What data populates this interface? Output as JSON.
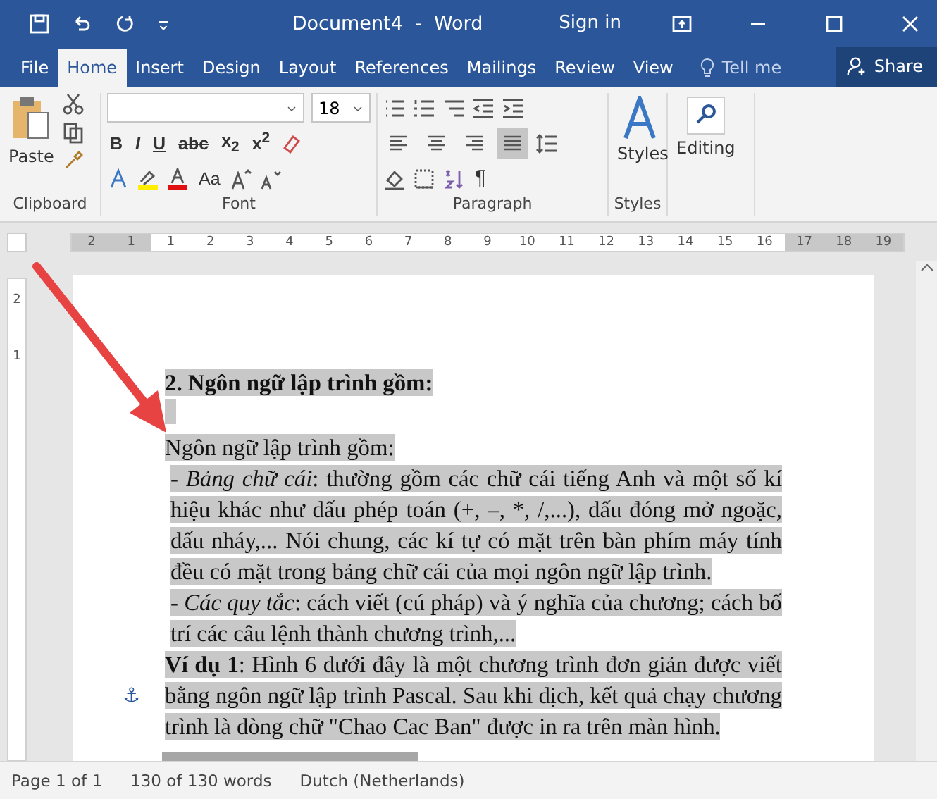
{
  "window": {
    "title": "Document4  -  Word",
    "sign_in": "Sign in"
  },
  "tabs": [
    {
      "label": "File",
      "selected": false
    },
    {
      "label": "Home",
      "selected": true
    },
    {
      "label": "Insert",
      "selected": false
    },
    {
      "label": "Design",
      "selected": false
    },
    {
      "label": "Layout",
      "selected": false
    },
    {
      "label": "References",
      "selected": false
    },
    {
      "label": "Mailings",
      "selected": false
    },
    {
      "label": "Review",
      "selected": false
    },
    {
      "label": "View",
      "selected": false
    }
  ],
  "tell_me": "Tell me",
  "share": "Share",
  "ribbon": {
    "clipboard": {
      "paste": "Paste",
      "label": "Clipboard"
    },
    "font": {
      "size": "18",
      "format_buttons": [
        "B",
        "I",
        "U",
        "abc",
        "x$_{2}$",
        "x$^{2}$"
      ],
      "case_button": "Aa",
      "label": "Font"
    },
    "paragraph": {
      "alignments": [
        {
          "kind": "left",
          "selected": false
        },
        {
          "kind": "center",
          "selected": false
        },
        {
          "kind": "right",
          "selected": false
        },
        {
          "kind": "justify",
          "selected": true
        }
      ],
      "pilcrow": "¶",
      "label": "Paragraph"
    },
    "styles": {
      "button": "Styles",
      "label": "Styles"
    },
    "editing": {
      "button": "Editing"
    }
  },
  "ruler": {
    "labels": [
      "2",
      "1",
      "1",
      "2",
      "3",
      "4",
      "5",
      "6",
      "7",
      "8",
      "9",
      "10",
      "11",
      "12",
      "13",
      "14",
      "15",
      "16",
      "17",
      "18",
      "19"
    ],
    "vertical_labels": [
      "2",
      "1"
    ]
  },
  "document": {
    "paragraphs": [
      {
        "kind": "heading",
        "text": "2. Ngôn ngữ lập trình gồm:"
      },
      {
        "kind": "blank"
      },
      {
        "kind": "body",
        "text": "Ngôn ngữ lập trình gồm:"
      },
      {
        "kind": "item",
        "text": "- *Bảng chữ cái*: thường gồm các chữ cái tiếng Anh và một số kí hiệu khác như dấu phép toán (+, –, *, /,...), dấu đóng mở ngoặc, dấu nháy,... Nói chung, các kí tự có mặt trên bàn phím máy tính đều có mặt trong bảng chữ cái của mọi ngôn ngữ lập trình."
      },
      {
        "kind": "item",
        "text": "- *Các quy tắc*: cách viết (cú pháp) và ý nghĩa của chương; cách bố trí các câu lệnh thành chương trình,..."
      },
      {
        "kind": "example",
        "text": "**Ví dụ 1**: Hình 6 dưới đây là một chương trình đơn giản được viết bằng ngôn ngữ lập trình Pascal. Sau khi dịch, kết quả chạy chương trình là dòng chữ \"Chao Cac Ban\" được in ra trên màn hình."
      }
    ]
  },
  "anchor": "⚓",
  "status_bar": {
    "page": "Page 1 of 1",
    "words": "130 of 130 words",
    "language": "Dutch (Netherlands)"
  }
}
